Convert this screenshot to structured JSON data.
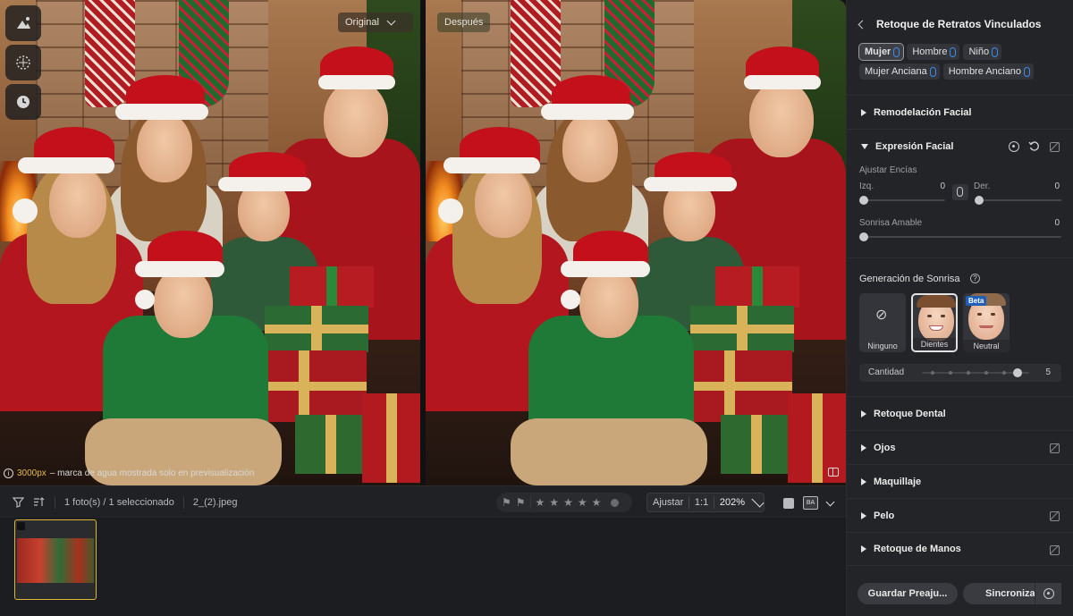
{
  "preview": {
    "original_label": "Original",
    "after_label": "Después",
    "watermark": {
      "px": "3000px",
      "text": " – marca de agua mostrada solo en previsualización"
    }
  },
  "toolstrip": {
    "icons": [
      "portrait-tool-icon",
      "texture-tool-icon",
      "history-clock-icon"
    ]
  },
  "filmbar": {
    "count_text": "1 foto(s) / 1 seleccionado",
    "filename": "2_(2).jpeg",
    "fit_label": "Ajustar",
    "one_to_one": "1:1",
    "zoom": "202%",
    "ba_label": "BA",
    "stars": 5,
    "star_glyph": "★",
    "flag_glyph": "⚑"
  },
  "panel": {
    "title": "Retoque de Retratos Vinculados",
    "chips": [
      {
        "label": "Mujer",
        "active": true
      },
      {
        "label": "Hombre",
        "active": false
      },
      {
        "label": "Niño",
        "active": false
      },
      {
        "label": "Mujer Anciana",
        "active": false
      },
      {
        "label": "Hombre Anciano",
        "active": false
      }
    ],
    "sections": {
      "remodelacion": "Remodelación Facial",
      "expresion": "Expresión Facial",
      "retoque_dental": "Retoque Dental",
      "ojos": "Ojos",
      "maquillaje": "Maquillaje",
      "pelo": "Pelo",
      "manos": "Retoque de Manos"
    },
    "expresion": {
      "encias_label": "Ajustar Encías",
      "izq_label": "Izq.",
      "izq_value": "0",
      "der_label": "Der.",
      "der_value": "0",
      "sonrisa_label": "Sonrisa Amable",
      "sonrisa_value": "0",
      "generacion_label": "Generación de Sonrisa",
      "help_glyph": "?",
      "options": [
        {
          "label": "Ninguno"
        },
        {
          "label": "Dientes"
        },
        {
          "label": "Neutral"
        }
      ],
      "none_glyph": "⊘",
      "beta": "Beta",
      "cantidad_label": "Cantidad",
      "cantidad_value": "5"
    },
    "footer": {
      "guardar": "Guardar Preaju...",
      "sincronizar": "Sincronizar"
    }
  }
}
